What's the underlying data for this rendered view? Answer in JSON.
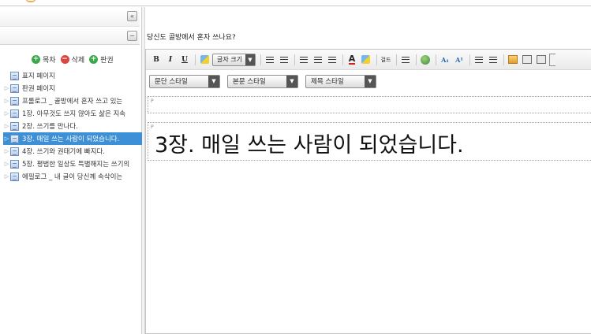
{
  "sidebar": {
    "actions": {
      "add_label": "목차",
      "delete_label": "삭제",
      "colophon_label": "판권"
    },
    "tree": [
      {
        "label": "표지 페이지",
        "has_arrow": false,
        "selected": false
      },
      {
        "label": "판권 페이지",
        "has_arrow": true,
        "selected": false
      },
      {
        "label": "프롤로그 _ 골방에서 혼자 쓰고 있는",
        "has_arrow": true,
        "selected": false
      },
      {
        "label": "1장. 아무것도 쓰지 않아도 삶은 지속",
        "has_arrow": true,
        "selected": false
      },
      {
        "label": "2장. 쓰기를 만나다.",
        "has_arrow": true,
        "selected": false
      },
      {
        "label": "3장. 매일 쓰는 사람이 되었습니다.",
        "has_arrow": true,
        "selected": true
      },
      {
        "label": "4장. 쓰기와 권태기에 빠지다.",
        "has_arrow": true,
        "selected": false
      },
      {
        "label": "5장. 평범한 일상도 특별해지는 쓰기의",
        "has_arrow": true,
        "selected": false
      },
      {
        "label": "에필로그 _ 내 글이 당신께 속삭이는",
        "has_arrow": true,
        "selected": false
      }
    ]
  },
  "editor": {
    "document_title": "당신도 골방에서 혼자 쓰나요?",
    "toolbar": {
      "bold": "B",
      "italic": "I",
      "underline": "U",
      "font_size_label": "글자 크기",
      "columns_label": "걸드"
    },
    "style_selects": {
      "paragraph_style": "문단 스타일",
      "body_style": "본문 스타일",
      "heading_style": "제목 스타일"
    },
    "paragraphs": [
      {
        "tag": "P",
        "text": ""
      },
      {
        "tag": "P",
        "text": "3장. 매일 쓰는 사람이 되었습니다."
      }
    ]
  },
  "colors": {
    "selection": "#3d8fd6",
    "add_icon": "#39a94a",
    "delete_icon": "#d9463f"
  }
}
